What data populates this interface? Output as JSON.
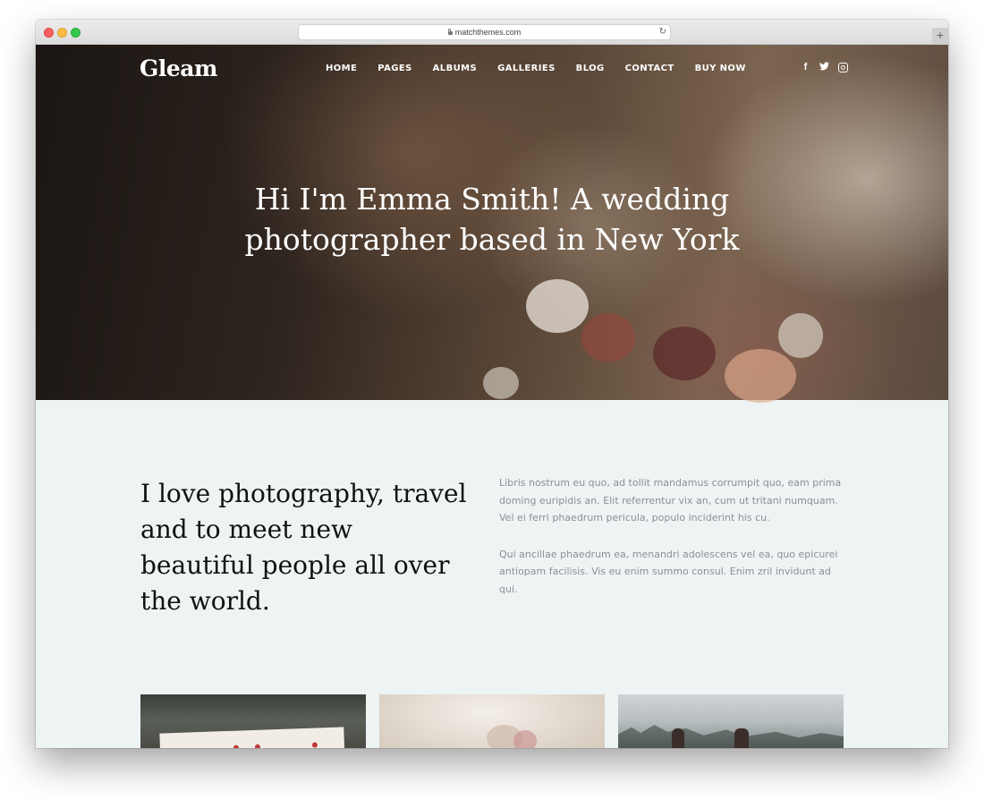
{
  "browser": {
    "url": "matchthemes.com"
  },
  "site": {
    "logo": "Gleam",
    "nav": [
      "HOME",
      "PAGES",
      "ALBUMS",
      "GALLERIES",
      "BLOG",
      "CONTACT",
      "BUY NOW"
    ],
    "social": {
      "facebook": "f",
      "icons": [
        "facebook-icon",
        "twitter-icon",
        "instagram-icon"
      ]
    }
  },
  "hero": {
    "title_line1": "Hi I'm Emma Smith! A wedding",
    "title_line2": "photographer based in New York"
  },
  "intro": {
    "heading": "I love photography, travel and to meet new beautiful people all over the world.",
    "paragraph1": "Libris nostrum eu quo, ad tollit mandamus corrumpit quo, eam prima doming euripidis an. Elit referrentur vix an, cum ut tritani numquam. Vel ei ferri phaedrum pericula, populo inciderint his cu.",
    "paragraph2": "Qui ancillae phaedrum ea, menandri adolescens vel ea, quo epicurei antiopam facilisis. Vis eu enim summo consul. Enim zril invidunt ad qui."
  },
  "colors": {
    "page_bg": "#eef4f4",
    "text_dark": "#111111",
    "text_muted": "#8a8f93"
  }
}
